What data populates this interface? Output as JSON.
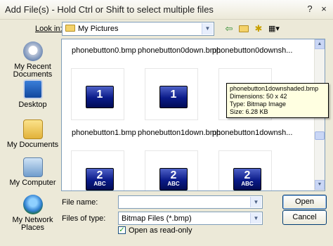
{
  "title": "Add File(s) - Hold Ctrl or Shift to select multiple files",
  "title_buttons": {
    "help": "?",
    "close": "×"
  },
  "look_in": {
    "label": "Look in:",
    "value": "My Pictures"
  },
  "places": [
    {
      "label_1": "My Recent",
      "label_2": "Documents",
      "icon": "recent-documents-icon"
    },
    {
      "label_1": "Desktop",
      "label_2": "",
      "icon": "desktop-icon"
    },
    {
      "label_1": "My Documents",
      "label_2": "",
      "icon": "my-documents-icon"
    },
    {
      "label_1": "My Computer",
      "label_2": "",
      "icon": "my-computer-icon"
    },
    {
      "label_1": "My Network",
      "label_2": "Places",
      "icon": "network-places-icon"
    }
  ],
  "files": [
    {
      "name": "phonebutton0.bmp"
    },
    {
      "name": "phonebutton0down.bmp"
    },
    {
      "name": "phonebutton0downsh..."
    },
    {
      "name": "phonebutton1.bmp",
      "glyph": "1"
    },
    {
      "name": "phonebutton1down.bmp",
      "glyph": "1"
    },
    {
      "name": "phonebutton1downsh...",
      "glyph": "1"
    },
    {
      "name": "",
      "glyph": "2",
      "sub": "ABC"
    },
    {
      "name": "",
      "glyph": "2",
      "sub": "ABC"
    },
    {
      "name": "",
      "glyph": "2",
      "sub": "ABC"
    }
  ],
  "tooltip": {
    "line1": "phonebutton1downshaded.bmp",
    "line2": "Dimensions: 50 x 42",
    "line3": "Type: Bitmap Image",
    "line4": "Size: 6.28 KB"
  },
  "file_name": {
    "label": "File name:",
    "value": ""
  },
  "files_of_type": {
    "label": "Files of type:",
    "value": "Bitmap Files (*.bmp)"
  },
  "open_readonly": {
    "label": "Open as read-only",
    "checked": true
  },
  "buttons": {
    "open": "Open",
    "cancel": "Cancel"
  },
  "toolbar": {
    "back": "⇦",
    "up": "↑",
    "new_folder": "✱",
    "views": "▦▾"
  }
}
